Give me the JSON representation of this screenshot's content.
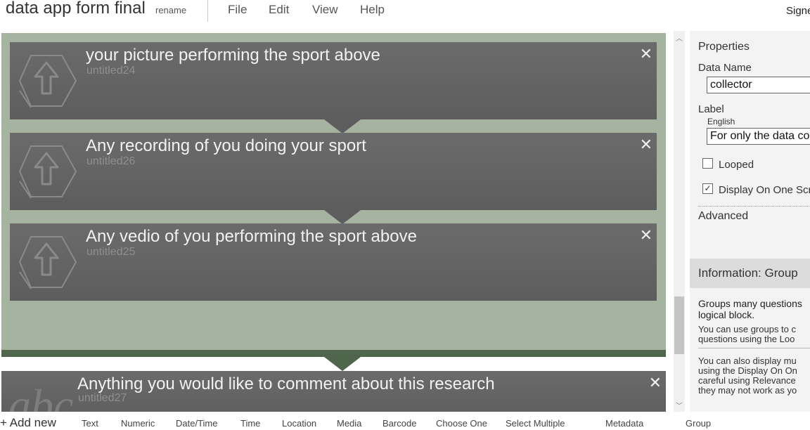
{
  "header": {
    "form_title": "data app form final",
    "rename_label": "rename",
    "menu": [
      "File",
      "Edit",
      "View",
      "Help"
    ],
    "signed_label": "Signe"
  },
  "questions": [
    {
      "title": "your picture performing the sport above",
      "name": "untitled24",
      "icon": "media-upload-icon"
    },
    {
      "title": "Any recording of you doing your sport",
      "name": "untitled26",
      "icon": "media-upload-icon"
    },
    {
      "title": "Any vedio of you performing the sport above",
      "name": "untitled25",
      "icon": "media-upload-icon"
    },
    {
      "title": "Anything you would like to comment about this research",
      "name": "untitled27",
      "icon": "text-abc-icon"
    }
  ],
  "close_glyph": "✕",
  "properties": {
    "heading": "Properties",
    "data_name_label": "Data Name",
    "data_name_value": "collector",
    "label_label": "Label",
    "language": "English",
    "label_value": "For only the data collector",
    "looped_label": "Looped",
    "looped_checked": false,
    "display_one_screen_label": "Display On One Screen",
    "display_one_screen_checked": true,
    "advanced_label": "Advanced"
  },
  "info": {
    "title": "Information: Group",
    "main_line1": "Groups many questions",
    "main_line2": "logical block.",
    "p1_line1": "You can use groups to c",
    "p1_line2": "questions using the Loo",
    "p2_line1": "You can also display mu",
    "p2_line2": "using the Display On On",
    "p2_line3": "careful using Relevance",
    "p2_line4": "they may not work as yo"
  },
  "toolbar": {
    "add_new": "+ Add new",
    "items": [
      "Text",
      "Numeric",
      "Date/Time",
      "Time",
      "Location",
      "Media",
      "Barcode",
      "Choose One",
      "Select Multiple",
      "Metadata",
      "Group"
    ]
  },
  "colors": {
    "group_background": "#a7b3a1",
    "group_bar": "#4f654c",
    "card_background": "#656565"
  }
}
